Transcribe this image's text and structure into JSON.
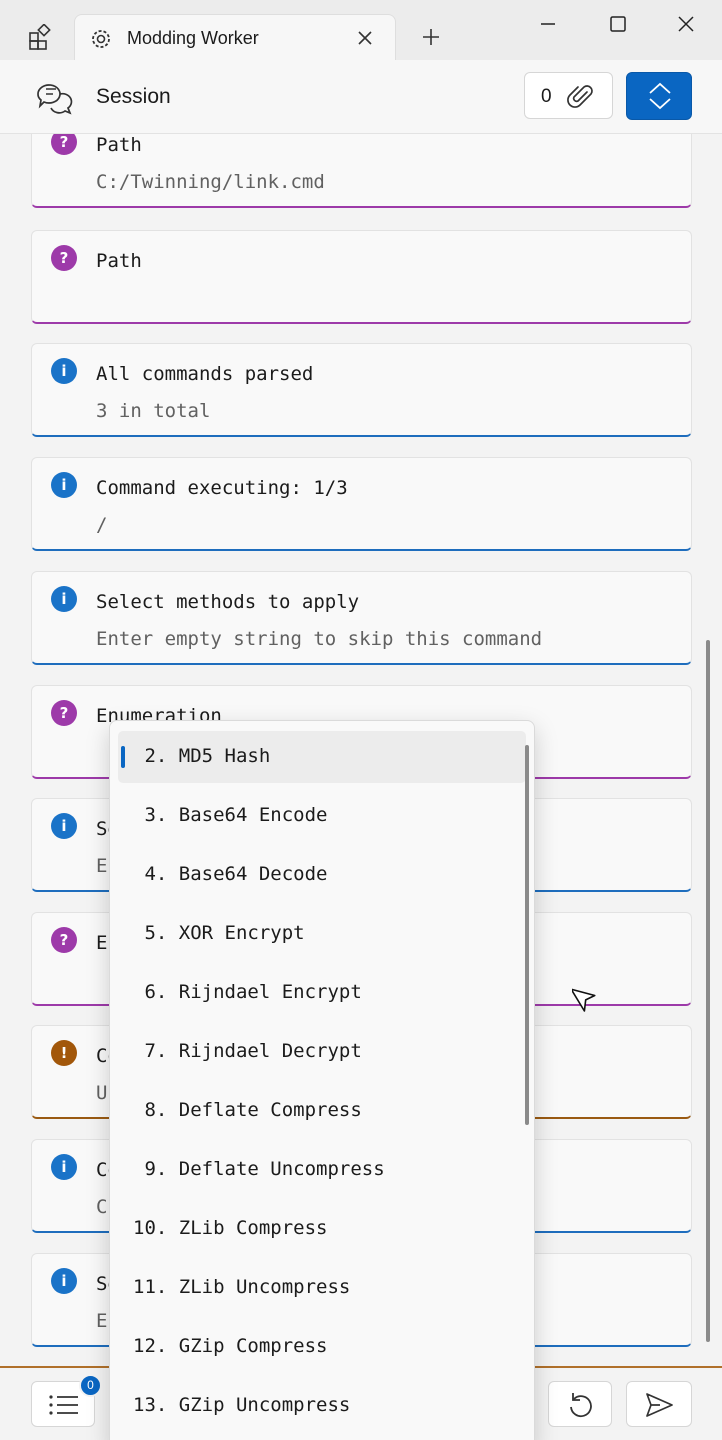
{
  "window": {
    "tab_title": "Modding Worker"
  },
  "header": {
    "title": "Session",
    "attachment_count": "0"
  },
  "cards": [
    {
      "kind": "question",
      "title": "Path",
      "subtitle": "C:/Twinning/link.cmd"
    },
    {
      "kind": "question",
      "title": "Path",
      "subtitle": ""
    },
    {
      "kind": "info",
      "title": "All commands parsed",
      "subtitle": "3 in total"
    },
    {
      "kind": "info",
      "title": "Command executing: 1/3",
      "subtitle": "/"
    },
    {
      "kind": "info",
      "title": "Select methods to apply",
      "subtitle": "Enter empty string to skip this command"
    },
    {
      "kind": "question",
      "title": "Enumeration",
      "subtitle": ""
    },
    {
      "kind": "info",
      "title": "Se",
      "subtitle": "En"
    },
    {
      "kind": "question",
      "title": "En",
      "subtitle": ""
    },
    {
      "kind": "warning",
      "title": "Co",
      "subtitle": "Ur"
    },
    {
      "kind": "info",
      "title": "Co",
      "subtitle": "C"
    },
    {
      "kind": "info",
      "title": "Se",
      "subtitle": "Er"
    }
  ],
  "badges": {
    "question": "?",
    "info": "i",
    "warning": "!"
  },
  "dropdown": {
    "items": [
      " 2. MD5 Hash",
      " 3. Base64 Encode",
      " 4. Base64 Decode",
      " 5. XOR Encrypt",
      " 6. Rijndael Encrypt",
      " 7. Rijndael Decrypt",
      " 8. Deflate Compress",
      " 9. Deflate Uncompress",
      "10. ZLib Compress",
      "11. ZLib Uncompress",
      "12. GZip Compress",
      "13. GZip Uncompress"
    ],
    "selected_index": 0
  },
  "bottom": {
    "queue_count": "0"
  },
  "colors": {
    "accent": "#0a66c2",
    "question": "#9d3aa9",
    "info": "#1a73c8",
    "warning": "#a2570a"
  },
  "icons": {
    "app": "widgets-icon",
    "tab": "gear-icon",
    "session": "chat-icon",
    "attach": "paperclip-icon",
    "expand": "expand-collapse-icon",
    "list": "list-icon",
    "undo": "undo-icon",
    "send": "send-icon"
  }
}
